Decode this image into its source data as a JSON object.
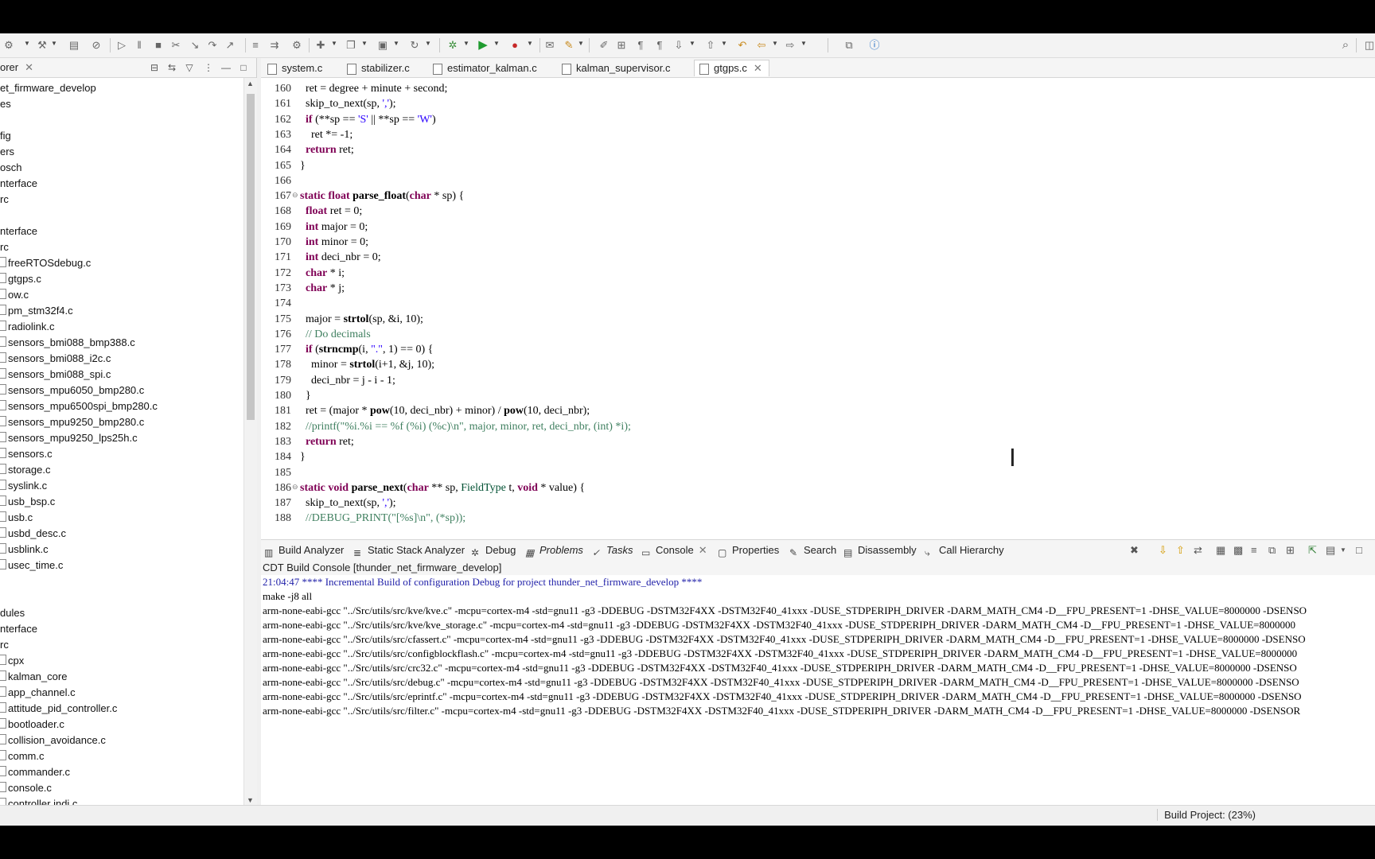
{
  "toolbar": {
    "icons": [
      "debug-config-icon",
      "hammer-icon",
      "build-all-icon",
      "skip-breakpoints-icon",
      "resume-icon",
      "suspend-icon",
      "terminate-icon",
      "disconnect-icon",
      "step-into-icon",
      "step-over-icon",
      "step-return-icon",
      "drop-to-frame-icon",
      "new-icon",
      "open-icon",
      "new-class-icon",
      "refresh-icon",
      "debug-icon",
      "run-icon",
      "external-tools-icon",
      "search-icon",
      "info-icon"
    ]
  },
  "explorer": {
    "tab_label": "orer",
    "items": [
      "et_firmware_develop",
      "es",
      "",
      "fig",
      "ers",
      "osch",
      "nterface",
      "rc",
      "",
      "nterface",
      "rc",
      "freeRTOSdebug.c",
      "gtgps.c",
      "ow.c",
      "pm_stm32f4.c",
      "radiolink.c",
      "sensors_bmi088_bmp388.c",
      "sensors_bmi088_i2c.c",
      "sensors_bmi088_spi.c",
      "sensors_mpu6050_bmp280.c",
      "sensors_mpu6500spi_bmp280.c",
      "sensors_mpu9250_bmp280.c",
      "sensors_mpu9250_lps25h.c",
      "sensors.c",
      "storage.c",
      "syslink.c",
      "usb_bsp.c",
      "usb.c",
      "usbd_desc.c",
      "usblink.c",
      "usec_time.c",
      "",
      "",
      "dules",
      "nterface",
      "rc",
      "cpx",
      "kalman_core",
      "app_channel.c",
      "attitude_pid_controller.c",
      "bootloader.c",
      "collision_avoidance.c",
      "comm.c",
      "commander.c",
      "console.c",
      "controller indi.c"
    ]
  },
  "editor": {
    "tabs": [
      "system.c",
      "stabilizer.c",
      "estimator_kalman.c",
      "kalman_supervisor.c",
      "gtgps.c"
    ],
    "active_tab": "gtgps.c",
    "lines": [
      {
        "n": "160",
        "t": "  ret = degree + minute + second;"
      },
      {
        "n": "161",
        "t": "  skip_to_next(sp, ',');"
      },
      {
        "n": "162",
        "t": "  if (**sp == 'S' || **sp == 'W')"
      },
      {
        "n": "163",
        "t": "    ret *= -1;"
      },
      {
        "n": "164",
        "t": "  return ret;"
      },
      {
        "n": "165",
        "t": "}"
      },
      {
        "n": "166",
        "t": ""
      },
      {
        "n": "167",
        "t": "static float parse_float(char * sp) {"
      },
      {
        "n": "168",
        "t": "  float ret = 0;"
      },
      {
        "n": "169",
        "t": "  int major = 0;"
      },
      {
        "n": "170",
        "t": "  int minor = 0;"
      },
      {
        "n": "171",
        "t": "  int deci_nbr = 0;"
      },
      {
        "n": "172",
        "t": "  char * i;"
      },
      {
        "n": "173",
        "t": "  char * j;"
      },
      {
        "n": "174",
        "t": ""
      },
      {
        "n": "175",
        "t": "  major = strtol(sp, &i, 10);"
      },
      {
        "n": "176",
        "t": "  // Do decimals"
      },
      {
        "n": "177",
        "t": "  if (strncmp(i, \".\", 1) == 0) {"
      },
      {
        "n": "178",
        "t": "    minor = strtol(i+1, &j, 10);"
      },
      {
        "n": "179",
        "t": "    deci_nbr = j - i - 1;"
      },
      {
        "n": "180",
        "t": "  }"
      },
      {
        "n": "181",
        "t": "  ret = (major * pow(10, deci_nbr) + minor) / pow(10, deci_nbr);"
      },
      {
        "n": "182",
        "t": "  //printf(\"%i.%i == %f (%i) (%c)\\n\", major, minor, ret, deci_nbr, (int) *i);"
      },
      {
        "n": "183",
        "t": "  return ret;"
      },
      {
        "n": "184",
        "t": "}"
      },
      {
        "n": "185",
        "t": ""
      },
      {
        "n": "186",
        "t": "static void parse_next(char ** sp, FieldType t, void * value) {"
      },
      {
        "n": "187",
        "t": "  skip_to_next(sp, ',');"
      },
      {
        "n": "188",
        "t": "  //DEBUG_PRINT(\"[%s]\\n\", (*sp));"
      }
    ]
  },
  "bottom": {
    "tabs": [
      "Build Analyzer",
      "Static Stack Analyzer",
      "Debug",
      "Problems",
      "Tasks",
      "Console",
      "Properties",
      "Search",
      "Disassembly",
      "Call Hierarchy"
    ],
    "console_title": "CDT Build Console [thunder_net_firmware_develop]",
    "console_lines": [
      "21:04:47 **** Incremental Build of configuration Debug for project thunder_net_firmware_develop ****",
      "make -j8 all",
      "arm-none-eabi-gcc \"../Src/utils/src/kve/kve.c\" -mcpu=cortex-m4 -std=gnu11 -g3 -DDEBUG -DSTM32F4XX -DSTM32F40_41xxx -DUSE_STDPERIPH_DRIVER -DARM_MATH_CM4 -D__FPU_PRESENT=1 -DHSE_VALUE=8000000 -DSENSO",
      "arm-none-eabi-gcc \"../Src/utils/src/kve/kve_storage.c\" -mcpu=cortex-m4 -std=gnu11 -g3 -DDEBUG -DSTM32F4XX -DSTM32F40_41xxx -DUSE_STDPERIPH_DRIVER -DARM_MATH_CM4 -D__FPU_PRESENT=1 -DHSE_VALUE=8000000",
      "arm-none-eabi-gcc \"../Src/utils/src/cfassert.c\" -mcpu=cortex-m4 -std=gnu11 -g3 -DDEBUG -DSTM32F4XX -DSTM32F40_41xxx -DUSE_STDPERIPH_DRIVER -DARM_MATH_CM4 -D__FPU_PRESENT=1 -DHSE_VALUE=8000000 -DSENSO",
      "arm-none-eabi-gcc \"../Src/utils/src/configblockflash.c\" -mcpu=cortex-m4 -std=gnu11 -g3 -DDEBUG -DSTM32F4XX -DSTM32F40_41xxx -DUSE_STDPERIPH_DRIVER -DARM_MATH_CM4 -D__FPU_PRESENT=1 -DHSE_VALUE=8000000",
      "arm-none-eabi-gcc \"../Src/utils/src/crc32.c\" -mcpu=cortex-m4 -std=gnu11 -g3 -DDEBUG -DSTM32F4XX -DSTM32F40_41xxx -DUSE_STDPERIPH_DRIVER -DARM_MATH_CM4 -D__FPU_PRESENT=1 -DHSE_VALUE=8000000 -DSENSO",
      "arm-none-eabi-gcc \"../Src/utils/src/debug.c\" -mcpu=cortex-m4 -std=gnu11 -g3 -DDEBUG -DSTM32F4XX -DSTM32F40_41xxx -DUSE_STDPERIPH_DRIVER -DARM_MATH_CM4 -D__FPU_PRESENT=1 -DHSE_VALUE=8000000 -DSENSO",
      "arm-none-eabi-gcc \"../Src/utils/src/eprintf.c\" -mcpu=cortex-m4 -std=gnu11 -g3 -DDEBUG -DSTM32F4XX -DSTM32F40_41xxx -DUSE_STDPERIPH_DRIVER -DARM_MATH_CM4 -D__FPU_PRESENT=1 -DHSE_VALUE=8000000 -DSENSO",
      "arm-none-eabi-gcc \"../Src/utils/src/filter.c\" -mcpu=cortex-m4 -std=gnu11 -g3 -DDEBUG -DSTM32F4XX -DSTM32F40_41xxx -DUSE_STDPERIPH_DRIVER -DARM_MATH_CM4 -D__FPU_PRESENT=1 -DHSE_VALUE=8000000 -DSENSOR"
    ]
  },
  "status": {
    "text": "Build Project: (23%)"
  }
}
